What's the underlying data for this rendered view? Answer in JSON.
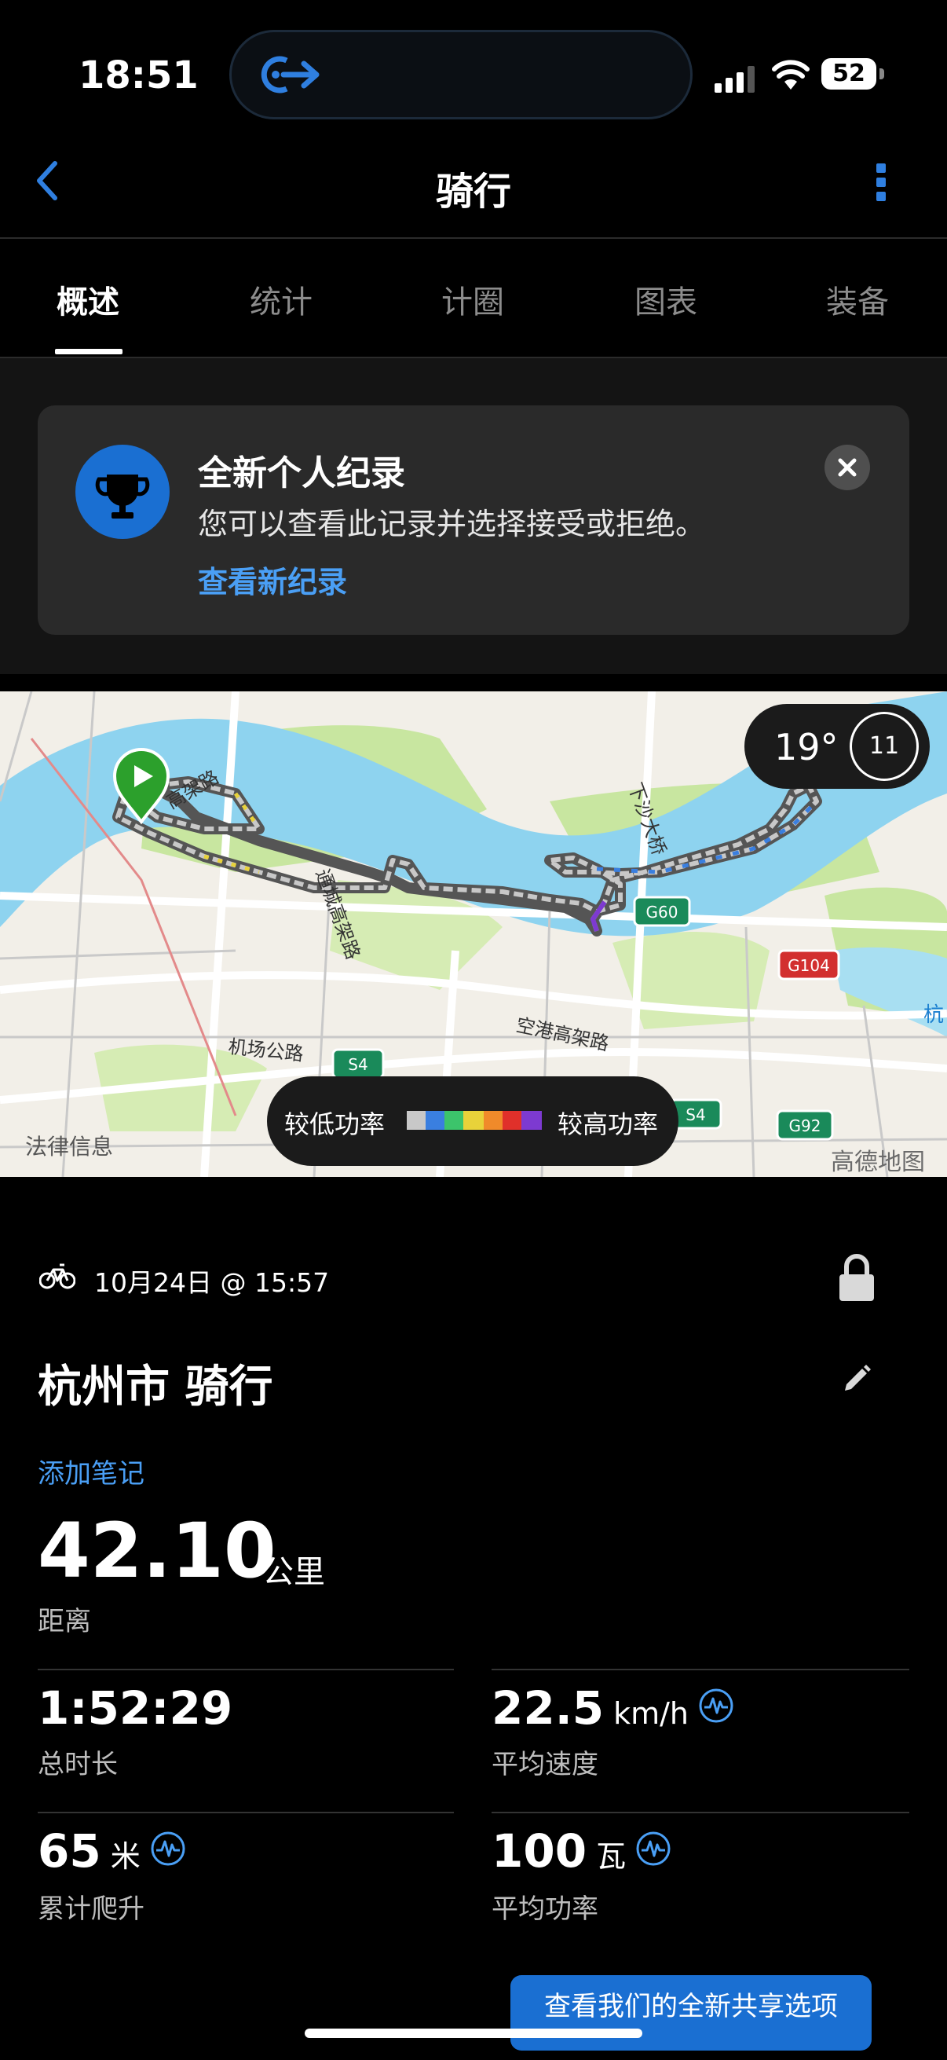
{
  "status_bar": {
    "time": "18:51",
    "battery": "52"
  },
  "nav": {
    "title": "骑行"
  },
  "tabs": [
    {
      "label": "概述",
      "active": true
    },
    {
      "label": "统计",
      "active": false
    },
    {
      "label": "计圈",
      "active": false
    },
    {
      "label": "图表",
      "active": false
    },
    {
      "label": "装备",
      "active": false
    }
  ],
  "record_card": {
    "title": "全新个人纪录",
    "description": "您可以查看此记录并选择接受或拒绝。",
    "link": "查看新纪录"
  },
  "map": {
    "temperature": "19°",
    "dial_value": "11",
    "legend_low": "较低功率",
    "legend_high": "较高功率",
    "legal": "法律信息",
    "brand": "高德地图",
    "labels": {
      "bridge": "下沙大桥",
      "road1": "通城高架路",
      "road2": "高架路",
      "road3": "空港高架路",
      "road4": "机场公路",
      "edge": "杭"
    },
    "shields": {
      "g60": "G60",
      "g104": "G104",
      "s4a": "S4",
      "s4b": "S4",
      "g92": "G92"
    },
    "colors": {
      "water": "#8ed3ef",
      "green": "#c8e6a0",
      "land": "#f2efe8",
      "start": "#2ca02c"
    }
  },
  "activity": {
    "date": "10月24日 @ 15:57",
    "title": "杭州市 骑行",
    "add_note": "添加笔记",
    "distance": {
      "value": "42.10",
      "unit": "公里",
      "label": "距离"
    },
    "stats": [
      {
        "value": "1:52:29",
        "unit": "",
        "label": "总时长"
      },
      {
        "value": "22.5",
        "unit": "km/h",
        "label": "平均速度"
      },
      {
        "value": "65",
        "unit": "米",
        "label": "累计爬升"
      },
      {
        "value": "100",
        "unit": "瓦",
        "label": "平均功率"
      }
    ]
  },
  "share_button": "查看我们的全新共享选项"
}
